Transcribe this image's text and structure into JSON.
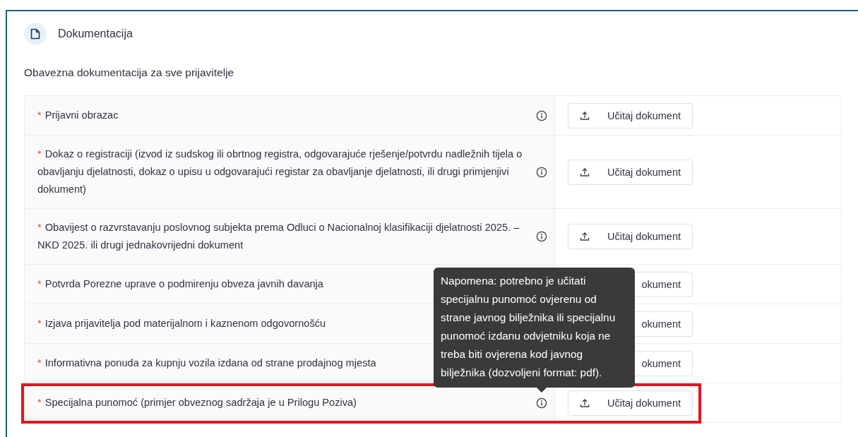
{
  "section": {
    "title": "Dokumentacija",
    "subtitle": "Obavezna dokumentacija za sve prijavitelje"
  },
  "documents": [
    {
      "marker": "*",
      "label": "Prijavni obrazac",
      "highlighted": false,
      "button": "Učitaj dokument"
    },
    {
      "marker": "*",
      "label": "Dokaz o registraciji (izvod iz sudskog ili obrtnog registra, odgovarajuće rješenje/potvrdu nadležnih tijela o obavljanju djelatnosti, dokaz o upisu u odgovarajući registar za obavljanje djelatnosti, ili drugi primjenjivi dokument)",
      "highlighted": false,
      "button": "Učitaj dokument"
    },
    {
      "marker": "*",
      "label": "Obavijest o razvrstavanju poslovnog subjekta prema Odluci o Nacionalnoj klasifikaciji djelatnosti 2025. – NKD 2025. ili drugi jednakovrijedni dokument",
      "highlighted": false,
      "button": "Učitaj dokument"
    },
    {
      "marker": "*",
      "label": "Potvrda Porezne uprave o podmirenju obveza javnih davanja",
      "highlighted": false,
      "button": "okument"
    },
    {
      "marker": "*",
      "label": "Izjava prijavitelja pod materijalnom i kaznenom odgovornošću",
      "highlighted": false,
      "button": "okument"
    },
    {
      "marker": "*",
      "label": "Informativna ponuda za kupnju vozila izdana od strane prodajnog mjesta",
      "highlighted": false,
      "button": "okument"
    },
    {
      "marker": "*",
      "label": "Specijalna punomoć (primjer obveznog sadržaja je u Prilogu Poziva)",
      "highlighted": true,
      "button": "Učitaj dokument",
      "tooltip": "Napomena: potrebno je učitati specijalnu punomoć ovjerenu od strane javnog bilježnika ili specijalnu punomoć izdanu odvjetniku koja ne treba biti ovjerena kod javnog bilježnika (dozvoljeni format: pdf)."
    }
  ]
}
